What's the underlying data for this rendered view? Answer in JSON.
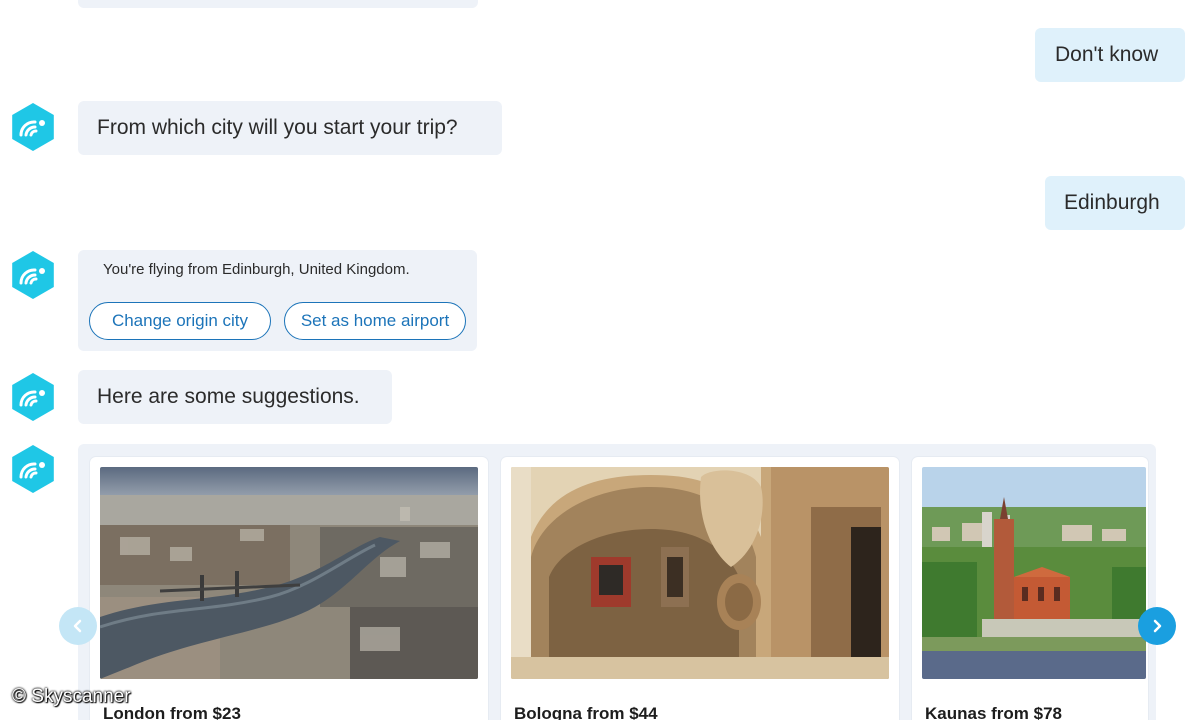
{
  "chat": {
    "messages": [
      {
        "from": "user",
        "text": "Don't know"
      },
      {
        "from": "bot",
        "text": "From which city will you start your trip?"
      },
      {
        "from": "user",
        "text": "Edinburgh"
      },
      {
        "from": "bot",
        "text": "You're flying from Edinburgh, United Kingdom."
      },
      {
        "from": "bot",
        "text": "Here are some suggestions."
      }
    ],
    "actions": {
      "change_origin": "Change origin city",
      "set_home": "Set as home airport"
    }
  },
  "suggestions": [
    {
      "title": "London from $23"
    },
    {
      "title": "Bologna from $44"
    },
    {
      "title": "Kaunas from $78"
    }
  ],
  "carousel": {
    "prev_icon": "chevron-left-icon",
    "next_icon": "chevron-right-icon"
  },
  "watermark": "© Skyscanner",
  "colors": {
    "brand_cyan": "#1fc7e6",
    "bot_bubble": "#eef2f8",
    "user_bubble": "#dff1fb",
    "link_blue": "#1c74b9",
    "carousel_button": "#1a9fe0"
  }
}
